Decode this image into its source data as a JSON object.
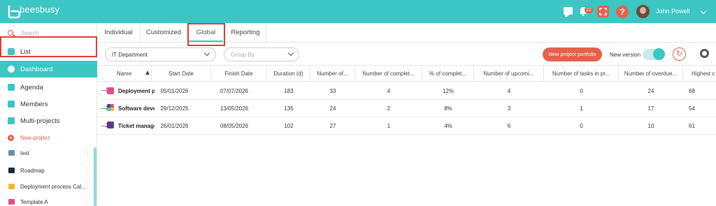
{
  "app": {
    "brand": "beesbusy",
    "user": "John Powell",
    "notifications": "22"
  },
  "sidebar": {
    "search_placeholder": "Search",
    "items": [
      {
        "label": "List"
      },
      {
        "label": "Dashboard"
      },
      {
        "label": "Agenda"
      },
      {
        "label": "Members"
      },
      {
        "label": "Multi-projects"
      }
    ],
    "new_project": "New project",
    "projects": [
      {
        "label": "test",
        "color": "#6a8fa8"
      },
      {
        "label": "Roadmap",
        "color": "#1e2a3a"
      },
      {
        "label": "Deployment process Cal...",
        "color": "#f3b731"
      },
      {
        "label": "Template A",
        "color": "#e64b8a"
      }
    ]
  },
  "tabs": [
    {
      "label": "Individual"
    },
    {
      "label": "Customized"
    },
    {
      "label": "Global"
    },
    {
      "label": "Reporting"
    }
  ],
  "toolbar": {
    "department": "IT Department",
    "group_by_placeholder": "Group By",
    "new_portfolio": "New project portfolio",
    "new_version": "New version"
  },
  "table": {
    "columns": [
      "Name",
      "Start Date",
      "Finish Date",
      "Duration (d)",
      "Number of...",
      "Number of complet...",
      "% of complet...",
      "Number of upcomi...",
      "Number of tasks in pr...",
      "Number of overdue...",
      "Highest c"
    ],
    "rows": [
      {
        "name": "Deployment pr",
        "start": "05/01/2026",
        "finish": "07/07/2026",
        "duration": "183",
        "n": "33",
        "completed": "4",
        "pct": "12%",
        "upcoming": "4",
        "in_progress": "0",
        "overdue": "24",
        "highest": "68",
        "icon_color": "#e64b8a"
      },
      {
        "name": "Software devel",
        "start": "29/12/2025",
        "finish": "13/05/2026",
        "duration": "135",
        "n": "24",
        "completed": "2",
        "pct": "8%",
        "upcoming": "3",
        "in_progress": "1",
        "overdue": "17",
        "highest": "54",
        "icon_color": "#f3b731"
      },
      {
        "name": "Ticket manage",
        "start": "26/01/2026",
        "finish": "08/05/2026",
        "duration": "102",
        "n": "27",
        "completed": "1",
        "pct": "4%",
        "upcoming": "6",
        "in_progress": "0",
        "overdue": "10",
        "highest": "61",
        "icon_color": "#5b3b8c"
      }
    ]
  },
  "colors": {
    "accent": "#3cc6c4",
    "orange": "#e8604c",
    "highlight": "#e33b34"
  }
}
